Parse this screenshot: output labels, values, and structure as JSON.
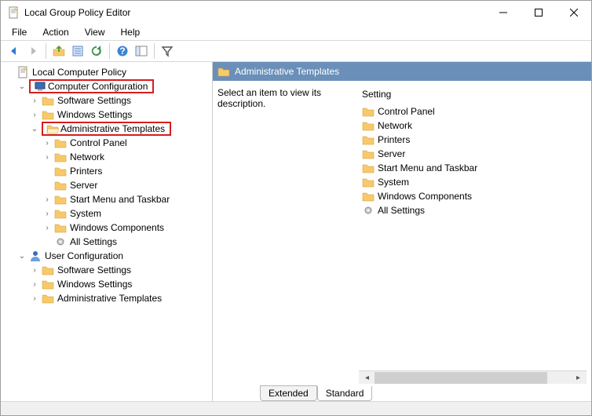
{
  "window": {
    "title": "Local Group Policy Editor"
  },
  "menu": {
    "file": "File",
    "action": "Action",
    "view": "View",
    "help": "Help"
  },
  "tree": {
    "root": "Local Computer Policy",
    "cc": "Computer Configuration",
    "cc_sw": "Software Settings",
    "cc_ws": "Windows Settings",
    "cc_at": "Administrative Templates",
    "cc_at_cp": "Control Panel",
    "cc_at_net": "Network",
    "cc_at_prn": "Printers",
    "cc_at_srv": "Server",
    "cc_at_smt": "Start Menu and Taskbar",
    "cc_at_sys": "System",
    "cc_at_wc": "Windows Components",
    "cc_at_as": "All Settings",
    "uc": "User Configuration",
    "uc_sw": "Software Settings",
    "uc_ws": "Windows Settings",
    "uc_at": "Administrative Templates"
  },
  "main": {
    "header": "Administrative Templates",
    "desc": "Select an item to view its description.",
    "setting_head": "Setting",
    "items": {
      "cp": "Control Panel",
      "net": "Network",
      "prn": "Printers",
      "srv": "Server",
      "smt": "Start Menu and Taskbar",
      "sys": "System",
      "wc": "Windows Components",
      "as": "All Settings"
    },
    "tab_extended": "Extended",
    "tab_standard": "Standard"
  }
}
